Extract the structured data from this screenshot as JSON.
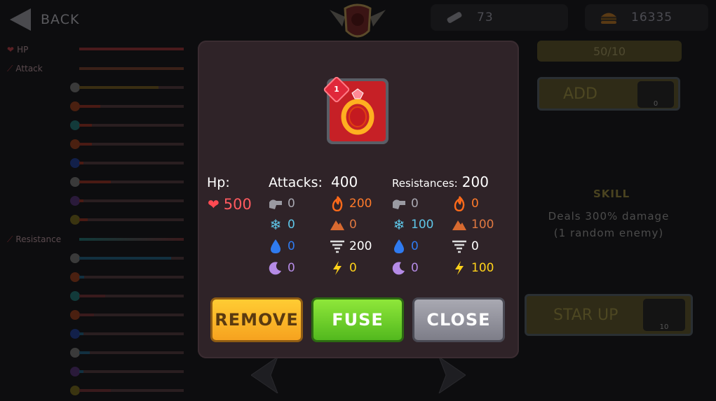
{
  "topbar": {
    "back_label": "BACK",
    "scrolls_count": "73",
    "coins_count": "16335"
  },
  "left_stats": {
    "hp_label": "HP",
    "attack_label": "Attack",
    "resistance_label": "Resistance",
    "hp_bar_fraction": 1.0,
    "attack_bar_fraction": 1.0
  },
  "right_panel": {
    "pieces_progress": "50/10",
    "add_label": "ADD",
    "add_slot_count": "0",
    "skill_title": "SKILL",
    "skill_desc_line1": "Deals 300% damage",
    "skill_desc_line2": "(1 random enemy)",
    "starup_label": "STAR UP",
    "starup_slot_count": "10"
  },
  "modal": {
    "item_level": "1",
    "hp_header": "Hp:",
    "hp_value": "500",
    "attacks_header": "Attacks:",
    "attacks_total": "400",
    "resist_header": "Resistances:",
    "resist_total": "200",
    "attacks": {
      "physical": "0",
      "fire": "200",
      "ice": "0",
      "earth": "0",
      "water": "0",
      "wind": "200",
      "dark": "0",
      "lightning": "0"
    },
    "resists": {
      "physical": "0",
      "fire": "0",
      "ice": "100",
      "earth": "100",
      "water": "0",
      "wind": "0",
      "dark": "0",
      "lightning": "100"
    },
    "buttons": {
      "remove": "REMOVE",
      "fuse": "FUSE",
      "close": "CLOSE"
    }
  },
  "colors": {
    "modal_bg": "#2f2328",
    "fire": "#ff7a2a",
    "ice": "#5ec6e8",
    "water": "#2f7bf0",
    "dark": "#b58be6",
    "lightning": "#ffd21a",
    "earth": "#e07840",
    "physical": "#a9a9b2",
    "hp": "#ff5a5f"
  }
}
